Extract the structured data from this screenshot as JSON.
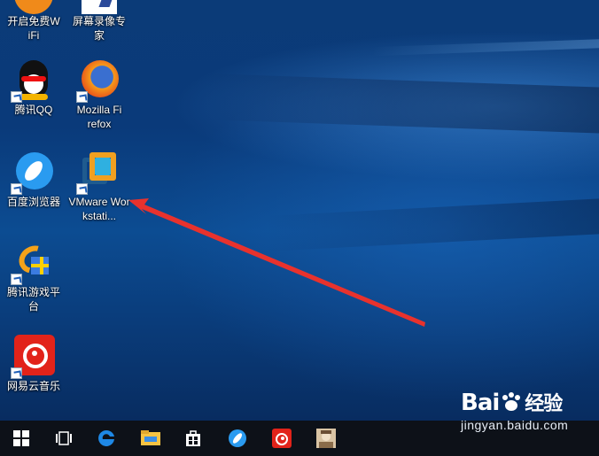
{
  "desktop": {
    "icons": [
      {
        "label": "开启免费WiFi",
        "icon": "wifi-app-icon"
      },
      {
        "label": "屏幕录像专家",
        "icon": "screen-recorder-icon"
      },
      {
        "label": "腾讯QQ",
        "icon": "qq-icon"
      },
      {
        "label": "Mozilla Firefox",
        "icon": "firefox-icon"
      },
      {
        "label": "百度浏览器",
        "icon": "baidu-browser-icon"
      },
      {
        "label": "VMware Workstati...",
        "icon": "vmware-icon"
      },
      {
        "label": "腾讯游戏平台",
        "icon": "tencent-game-icon"
      },
      {
        "label": "网易云音乐",
        "icon": "netease-music-icon"
      }
    ]
  },
  "annotation": {
    "color": "#e8322d",
    "icon": "red-arrow-icon"
  },
  "taskbar": {
    "items": [
      {
        "icon": "windows-start-icon"
      },
      {
        "icon": "task-view-icon"
      },
      {
        "icon": "edge-icon"
      },
      {
        "icon": "file-explorer-icon"
      },
      {
        "icon": "store-icon"
      },
      {
        "icon": "baidu-browser-icon"
      },
      {
        "icon": "netease-music-icon"
      },
      {
        "icon": "user-photo-icon"
      }
    ]
  },
  "watermark": {
    "logo": "Bai",
    "logo_cn": "经验",
    "url": "jingyan.baidu.com"
  }
}
